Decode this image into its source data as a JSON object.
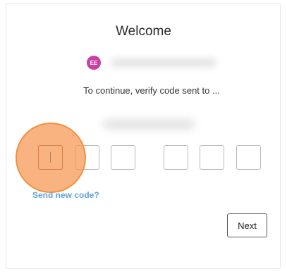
{
  "header": {
    "title": "Welcome"
  },
  "account": {
    "avatar_initials": "EE",
    "avatar_color": "#cc3fa4"
  },
  "instruction": {
    "text": "To continue, verify code sent to ..."
  },
  "code_inputs": {
    "count": 6,
    "values": [
      "",
      "",
      "",
      "",
      "",
      ""
    ],
    "focused_index": 0
  },
  "links": {
    "send_new_code": "Send new code?",
    "link_color": "#5fa3dc"
  },
  "actions": {
    "next_label": "Next"
  },
  "tap_indicator": {
    "color": "#f6964f"
  }
}
